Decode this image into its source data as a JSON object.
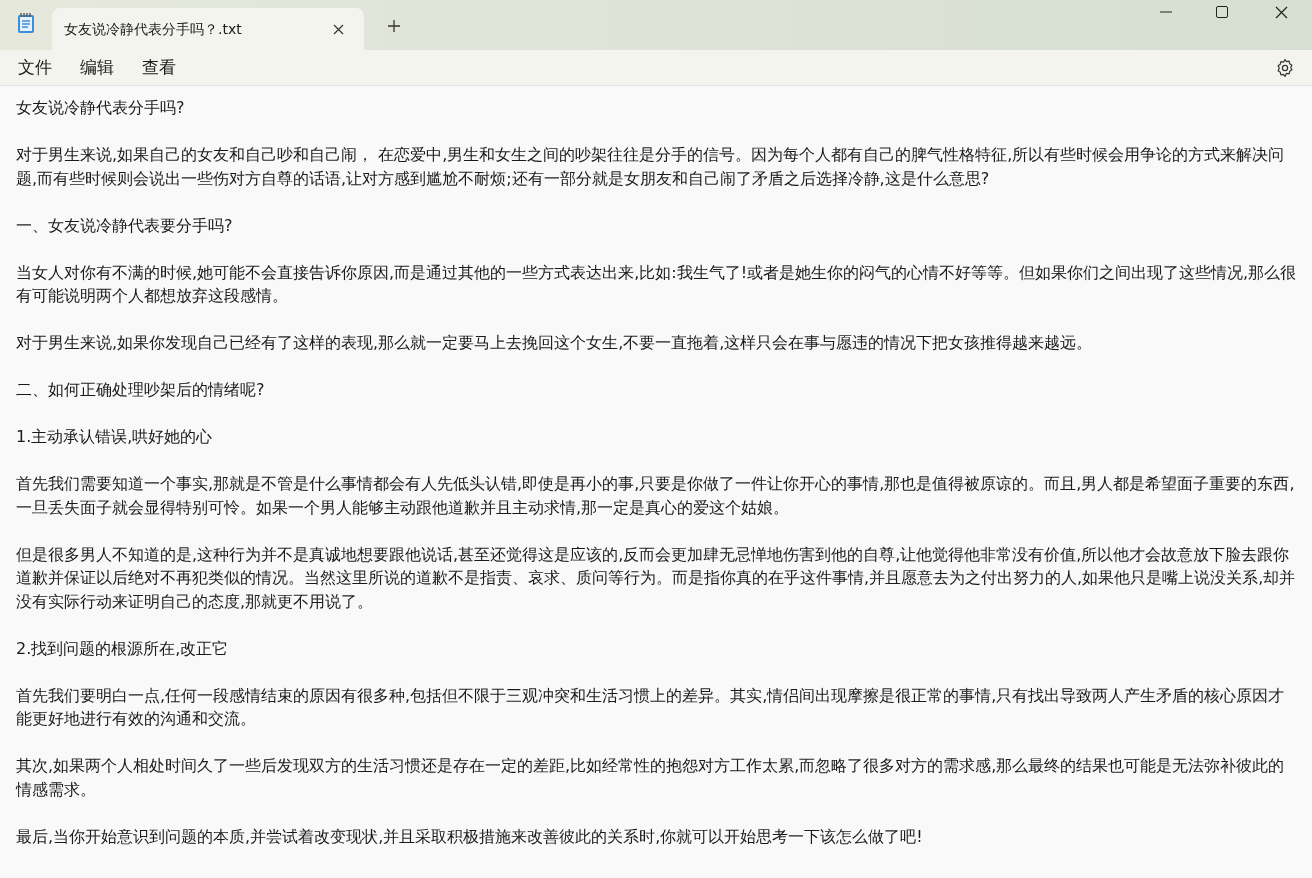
{
  "tabs": [
    {
      "label": "女友说冷静代表分手吗？.txt",
      "selected": true
    }
  ],
  "menu": [
    "文件",
    "编辑",
    "查看"
  ],
  "paragraphs": [
    "女友说冷静代表分手吗?",
    "对于男生来说,如果自己的女友和自己吵和自己闹， 在恋爱中,男生和女生之间的吵架往往是分手的信号。因为每个人都有自己的脾气性格特征,所以有些时候会用争论的方式来解决问题,而有些时候则会说出一些伤对方自尊的话语,让对方感到尴尬不耐烦;还有一部分就是女朋友和自己闹了矛盾之后选择冷静,这是什么意思?",
    "一、女友说冷静代表要分手吗?",
    "当女人对你有不满的时候,她可能不会直接告诉你原因,而是通过其他的一些方式表达出来,比如:我生气了!或者是她生你的闷气的心情不好等等。但如果你们之间出现了这些情况,那么很有可能说明两个人都想放弃这段感情。",
    "对于男生来说,如果你发现自己已经有了这样的表现,那么就一定要马上去挽回这个女生,不要一直拖着,这样只会在事与愿违的情况下把女孩推得越来越远。",
    "二、如何正确处理吵架后的情绪呢?",
    "1.主动承认错误,哄好她的心",
    "首先我们需要知道一个事实,那就是不管是什么事情都会有人先低头认错,即使是再小的事,只要是你做了一件让你开心的事情,那也是值得被原谅的。而且,男人都是希望面子重要的东西,一旦丢失面子就会显得特别可怜。如果一个男人能够主动跟他道歉并且主动求情,那一定是真心的爱这个姑娘。",
    "但是很多男人不知道的是,这种行为并不是真诚地想要跟他说话,甚至还觉得这是应该的,反而会更加肆无忌惮地伤害到他的自尊,让他觉得他非常没有价值,所以他才会故意放下脸去跟你道歉并保证以后绝对不再犯类似的情况。当然这里所说的道歉不是指责、哀求、质问等行为。而是指你真的在乎这件事情,并且愿意去为之付出努力的人,如果他只是嘴上说没关系,却并没有实际行动来证明自己的态度,那就更不用说了。",
    "2.找到问题的根源所在,改正它",
    "首先我们要明白一点,任何一段感情结束的原因有很多种,包括但不限于三观冲突和生活习惯上的差异。其实,情侣间出现摩擦是很正常的事情,只有找出导致两人产生矛盾的核心原因才能更好地进行有效的沟通和交流。",
    "其次,如果两个人相处时间久了一些后发现双方的生活习惯还是存在一定的差距,比如经常性的抱怨对方工作太累,而忽略了很多对方的需求感,那么最终的结果也可能是无法弥补彼此的情感需求。",
    "最后,当你开始意识到问题的本质,并尝试着改变现状,并且采取积极措施来改善彼此的关系时,你就可以开始思考一下该怎么做了吧!"
  ]
}
